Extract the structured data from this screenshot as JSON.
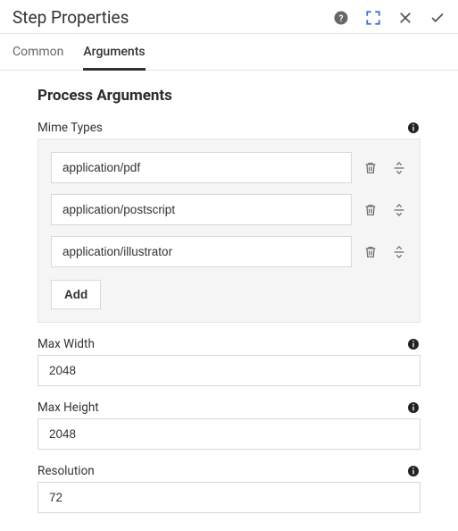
{
  "header": {
    "title": "Step Properties"
  },
  "tabs": {
    "items": [
      {
        "label": "Common",
        "active": false
      },
      {
        "label": "Arguments",
        "active": true
      }
    ]
  },
  "section": {
    "title": "Process Arguments"
  },
  "mime": {
    "label": "Mime Types",
    "items": [
      {
        "value": "application/pdf"
      },
      {
        "value": "application/postscript"
      },
      {
        "value": "application/illustrator"
      }
    ],
    "add_label": "Add"
  },
  "fields": {
    "max_width": {
      "label": "Max Width",
      "value": "2048"
    },
    "max_height": {
      "label": "Max Height",
      "value": "2048"
    },
    "resolution": {
      "label": "Resolution",
      "value": "72"
    }
  }
}
